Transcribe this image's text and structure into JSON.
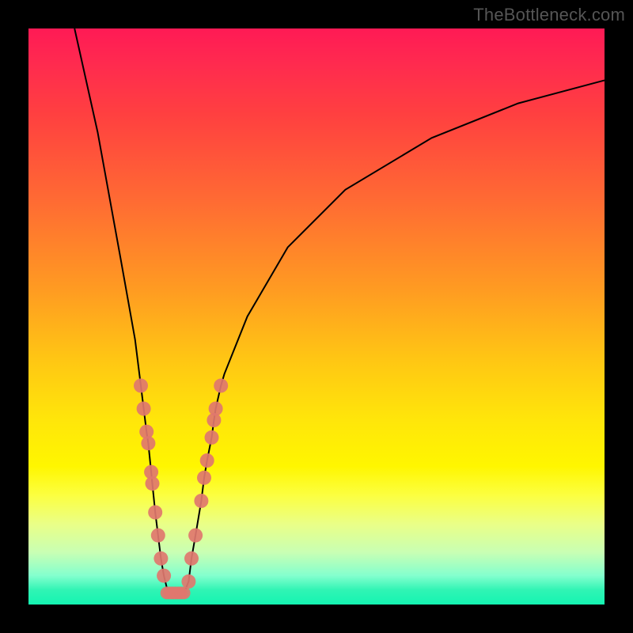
{
  "watermark": "TheBottleneck.com",
  "chart_data": {
    "type": "line",
    "title": "",
    "xlabel": "",
    "ylabel": "",
    "x_range": [
      0,
      100
    ],
    "y_range": [
      0,
      100
    ],
    "grid": false,
    "legend": false,
    "background": "rainbow-gradient",
    "series": [
      {
        "name": "bottleneck-curve",
        "description": "V-shaped curve with minimum at optimal balance point",
        "points": [
          {
            "x": 8,
            "y": 100
          },
          {
            "x": 12,
            "y": 82
          },
          {
            "x": 16,
            "y": 60
          },
          {
            "x": 18.5,
            "y": 46
          },
          {
            "x": 19.5,
            "y": 38
          },
          {
            "x": 20,
            "y": 34
          },
          {
            "x": 20.5,
            "y": 30
          },
          {
            "x": 20.8,
            "y": 28
          },
          {
            "x": 21.3,
            "y": 23
          },
          {
            "x": 21.5,
            "y": 21
          },
          {
            "x": 22,
            "y": 16
          },
          {
            "x": 22.5,
            "y": 12
          },
          {
            "x": 23,
            "y": 8
          },
          {
            "x": 23.5,
            "y": 5
          },
          {
            "x": 24,
            "y": 3
          },
          {
            "x": 24.5,
            "y": 2
          },
          {
            "x": 25,
            "y": 2
          },
          {
            "x": 25.5,
            "y": 2
          },
          {
            "x": 26,
            "y": 2
          },
          {
            "x": 26.5,
            "y": 2
          },
          {
            "x": 27,
            "y": 2
          },
          {
            "x": 27.8,
            "y": 4
          },
          {
            "x": 28.3,
            "y": 8
          },
          {
            "x": 29,
            "y": 12
          },
          {
            "x": 30,
            "y": 18
          },
          {
            "x": 30.5,
            "y": 22
          },
          {
            "x": 31,
            "y": 25
          },
          {
            "x": 31.8,
            "y": 29
          },
          {
            "x": 32.2,
            "y": 32
          },
          {
            "x": 32.5,
            "y": 34
          },
          {
            "x": 33.4,
            "y": 38
          },
          {
            "x": 34,
            "y": 40
          },
          {
            "x": 38,
            "y": 50
          },
          {
            "x": 45,
            "y": 62
          },
          {
            "x": 55,
            "y": 72
          },
          {
            "x": 70,
            "y": 81
          },
          {
            "x": 85,
            "y": 87
          },
          {
            "x": 100,
            "y": 91
          }
        ]
      },
      {
        "name": "markers-left",
        "type": "scatter",
        "color": "#e0776e",
        "points": [
          {
            "x": 19.5,
            "y": 38
          },
          {
            "x": 20,
            "y": 34
          },
          {
            "x": 20.5,
            "y": 30
          },
          {
            "x": 20.8,
            "y": 28
          },
          {
            "x": 21.3,
            "y": 23
          },
          {
            "x": 21.5,
            "y": 21
          },
          {
            "x": 22,
            "y": 16
          },
          {
            "x": 22.5,
            "y": 12
          },
          {
            "x": 23,
            "y": 8
          },
          {
            "x": 23.5,
            "y": 5
          }
        ]
      },
      {
        "name": "markers-bottom",
        "type": "scatter",
        "color": "#e0776e",
        "points": [
          {
            "x": 24,
            "y": 2
          },
          {
            "x": 24.5,
            "y": 2
          },
          {
            "x": 25,
            "y": 2
          },
          {
            "x": 25.5,
            "y": 2
          },
          {
            "x": 26,
            "y": 2
          },
          {
            "x": 26.5,
            "y": 2
          },
          {
            "x": 27,
            "y": 2
          }
        ]
      },
      {
        "name": "markers-right",
        "type": "scatter",
        "color": "#e0776e",
        "points": [
          {
            "x": 27.8,
            "y": 4
          },
          {
            "x": 28.3,
            "y": 8
          },
          {
            "x": 29,
            "y": 12
          },
          {
            "x": 30,
            "y": 18
          },
          {
            "x": 30.5,
            "y": 22
          },
          {
            "x": 31,
            "y": 25
          },
          {
            "x": 31.8,
            "y": 29
          },
          {
            "x": 32.2,
            "y": 32
          },
          {
            "x": 32.5,
            "y": 34
          },
          {
            "x": 33.4,
            "y": 38
          }
        ]
      }
    ]
  }
}
